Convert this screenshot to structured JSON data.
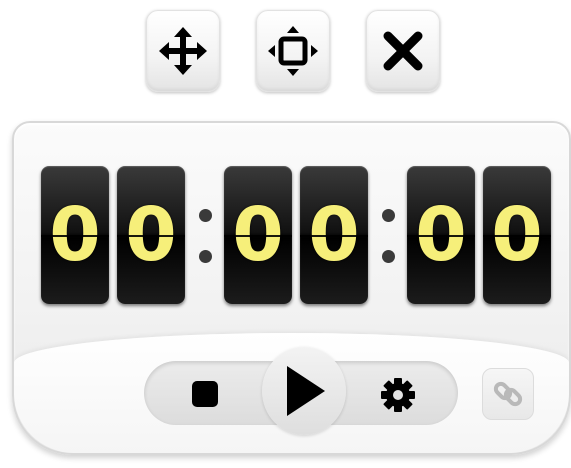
{
  "window_controls": [
    {
      "name": "move",
      "icon": "move-arrows-icon"
    },
    {
      "name": "resize",
      "icon": "resize-icon"
    },
    {
      "name": "close",
      "icon": "close-icon"
    }
  ],
  "timer": {
    "digits": [
      "0",
      "0",
      "0",
      "0",
      "0",
      "0"
    ],
    "separator": ":",
    "digit_color": "#f6ef7a",
    "card_color": "#000000"
  },
  "controls": {
    "stop_icon": "stop-square-icon",
    "play_icon": "play-triangle-icon",
    "settings_icon": "gear-icon",
    "link_icon": "link-chain-icon"
  }
}
